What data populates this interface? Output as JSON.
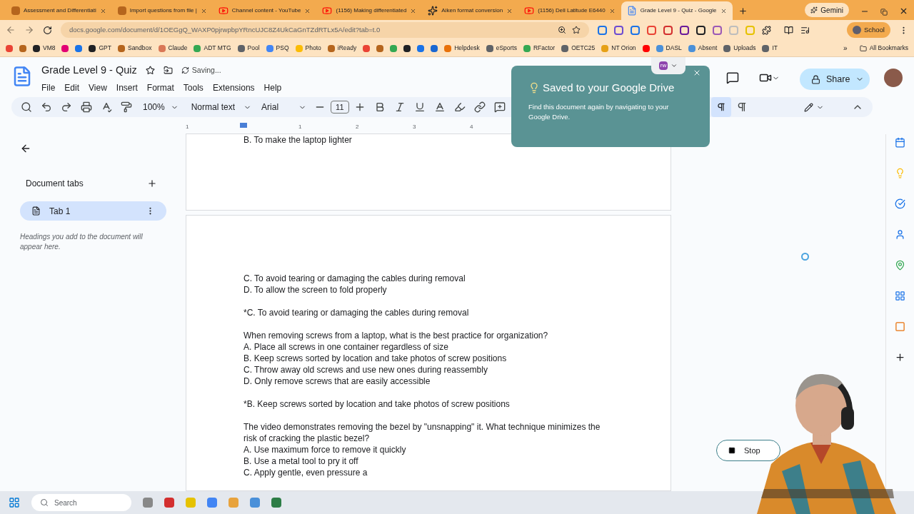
{
  "browser": {
    "tabs": [
      {
        "title": "Assessment and Differentiati",
        "selected": false,
        "kind": "logo"
      },
      {
        "title": "Import questions from file |",
        "selected": false,
        "kind": "logo"
      },
      {
        "title": "Channel content - YouTube",
        "selected": false,
        "kind": "youtube"
      },
      {
        "title": "(1156) Making differentiated",
        "selected": false,
        "kind": "youtube"
      },
      {
        "title": "Aiken format conversion",
        "selected": false,
        "kind": "gpt"
      },
      {
        "title": "(1156) Dell Latitude E6440",
        "selected": false,
        "kind": "youtube"
      },
      {
        "title": "Grade Level 9 - Quiz - Google",
        "selected": true,
        "kind": "docs"
      }
    ],
    "gemini": "Gemini",
    "url": "docs.google.com/document/d/1OEGgQ_WAXP0pjrwpbpYRncUJC8Z4UkCaGnTZdRTLx5A/edit?tab=t.0",
    "profile": "School",
    "bookmarks": [
      {
        "color": "#ea4335"
      },
      {
        "color": "#b5651d"
      },
      {
        "label": "VM8",
        "color": "#202124"
      },
      {
        "color": "#e20074"
      },
      {
        "color": "#1a73e8"
      },
      {
        "label": "GPT",
        "color": "#202124"
      },
      {
        "label": "Sandbox",
        "color": "#b5651d"
      },
      {
        "label": "Claude",
        "color": "#d97757"
      },
      {
        "label": "ADT MTG",
        "color": "#34a853"
      },
      {
        "label": "Pool",
        "color": "#5f6368"
      },
      {
        "label": "PSQ",
        "color": "#4285f4"
      },
      {
        "label": "Photo",
        "color": "#fbbc04"
      },
      {
        "label": "iReady",
        "color": "#b5651d"
      },
      {
        "color": "#ea4335"
      },
      {
        "color": "#b5651d"
      },
      {
        "color": "#34a853"
      },
      {
        "color": "#202124"
      },
      {
        "color": "#1a73e8"
      },
      {
        "color": "#1967d2"
      },
      {
        "label": "Helpdesk",
        "color": "#e8710a"
      },
      {
        "label": "eSports",
        "color": "#5f6368"
      },
      {
        "label": "RFactor",
        "color": "#34a853"
      },
      {
        "label": "OETC25",
        "color": "#5f6368"
      },
      {
        "label": "NT Orion",
        "color": "#e6a117"
      },
      {
        "color": "#ff0000"
      },
      {
        "label": "DASL",
        "color": "#4a90d9"
      },
      {
        "label": "Absent",
        "color": "#4a90d9"
      },
      {
        "label": "Uploads",
        "color": "#5f6368"
      },
      {
        "label": "IT",
        "color": "#5f6368"
      }
    ],
    "more_bookmarks": "»",
    "all_bookmarks": "All Bookmarks"
  },
  "docs": {
    "title": "Grade Level 9 - Quiz",
    "status": "Saving...",
    "menus": [
      "File",
      "Edit",
      "View",
      "Insert",
      "Format",
      "Tools",
      "Extensions",
      "Help"
    ],
    "zoom": "100%",
    "style": "Normal text",
    "font": "Arial",
    "font_size": "11",
    "share": "Share",
    "ruler": [
      "1",
      "1",
      "2",
      "3",
      "4"
    ]
  },
  "sidebar": {
    "heading": "Document tabs",
    "tabs": [
      {
        "label": "Tab 1",
        "selected": true
      }
    ],
    "hint": "Headings you add to the document will appear here."
  },
  "pages": [
    {
      "paragraphs": [
        [
          "B. To make the laptop lighter"
        ]
      ]
    },
    {
      "paragraphs": [
        [
          "C. To avoid tearing or damaging the cables during removal",
          "D. To allow the screen to fold properly"
        ],
        [
          "*C. To avoid tearing or damaging the cables during removal"
        ],
        [
          "When removing screws from a laptop, what is the best practice for organization?",
          "A. Place all screws in one container regardless of size",
          "B. Keep screws sorted by location and take photos of screw positions",
          "C. Throw away old screws and use new ones during reassembly",
          "D. Only remove screws that are easily accessible"
        ],
        [
          "*B. Keep screws sorted by location and take photos of screw positions"
        ],
        [
          "The video demonstrates removing the bezel by \"unsnapping\" it. What technique minimizes the risk of cracking the plastic bezel?",
          "A. Use maximum force to remove it quickly",
          "B. Use a metal tool to pry it off",
          "C. Apply gentle, even pressure a"
        ]
      ]
    }
  ],
  "toast": {
    "title": "Saved to your Google Drive",
    "body": "Find this document again by navigating to your Google Drive.",
    "extension": "rw"
  },
  "recording": {
    "stop": "Stop"
  },
  "taskbar": {
    "search_placeholder": "Search"
  }
}
